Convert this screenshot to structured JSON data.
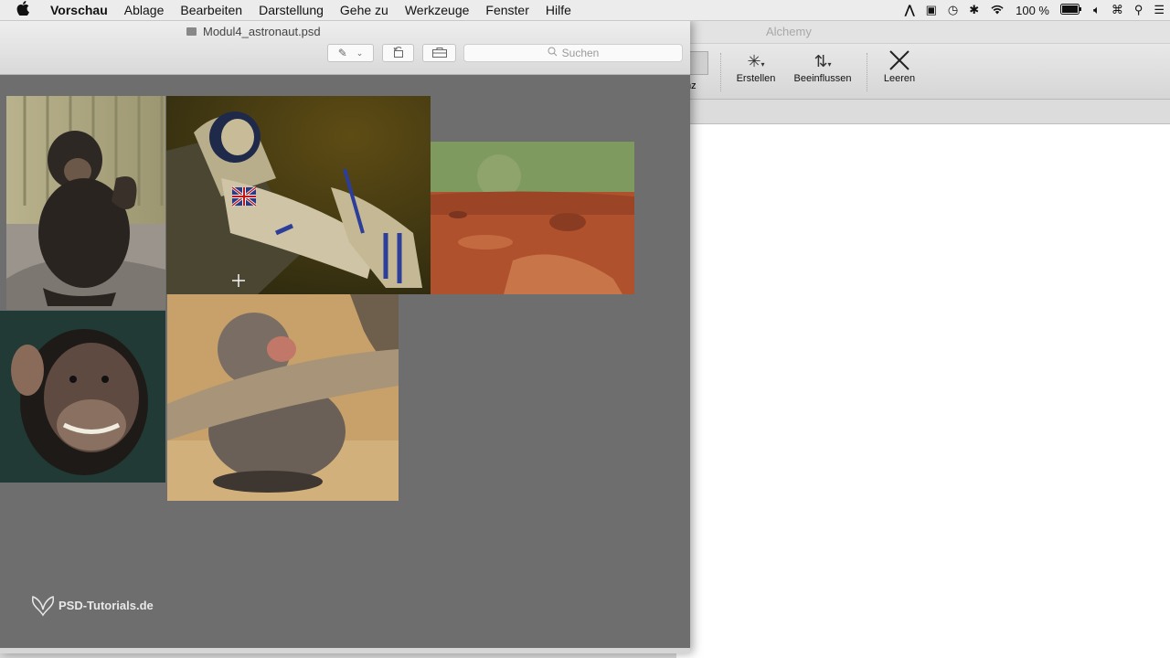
{
  "menubar": {
    "apple": "",
    "items": [
      "Vorschau",
      "Ablage",
      "Bearbeiten",
      "Darstellung",
      "Gehe zu",
      "Werkzeuge",
      "Fenster",
      "Hilfe"
    ],
    "battery": "100 %"
  },
  "preview": {
    "title": "Modul4_astronaut.psd",
    "search_placeholder": "Suchen"
  },
  "alchemy": {
    "title": "Alchemy",
    "partial_label": "nz",
    "buttons": {
      "erstellen": "Erstellen",
      "beeinflussen": "Beeinflussen",
      "leeren": "Leeren"
    }
  },
  "watermark": "PSD-Tutorials.de",
  "colors": {
    "canvas": "#6e6e6e",
    "sky": "#7f9a5e",
    "mars": "#b0512e"
  }
}
